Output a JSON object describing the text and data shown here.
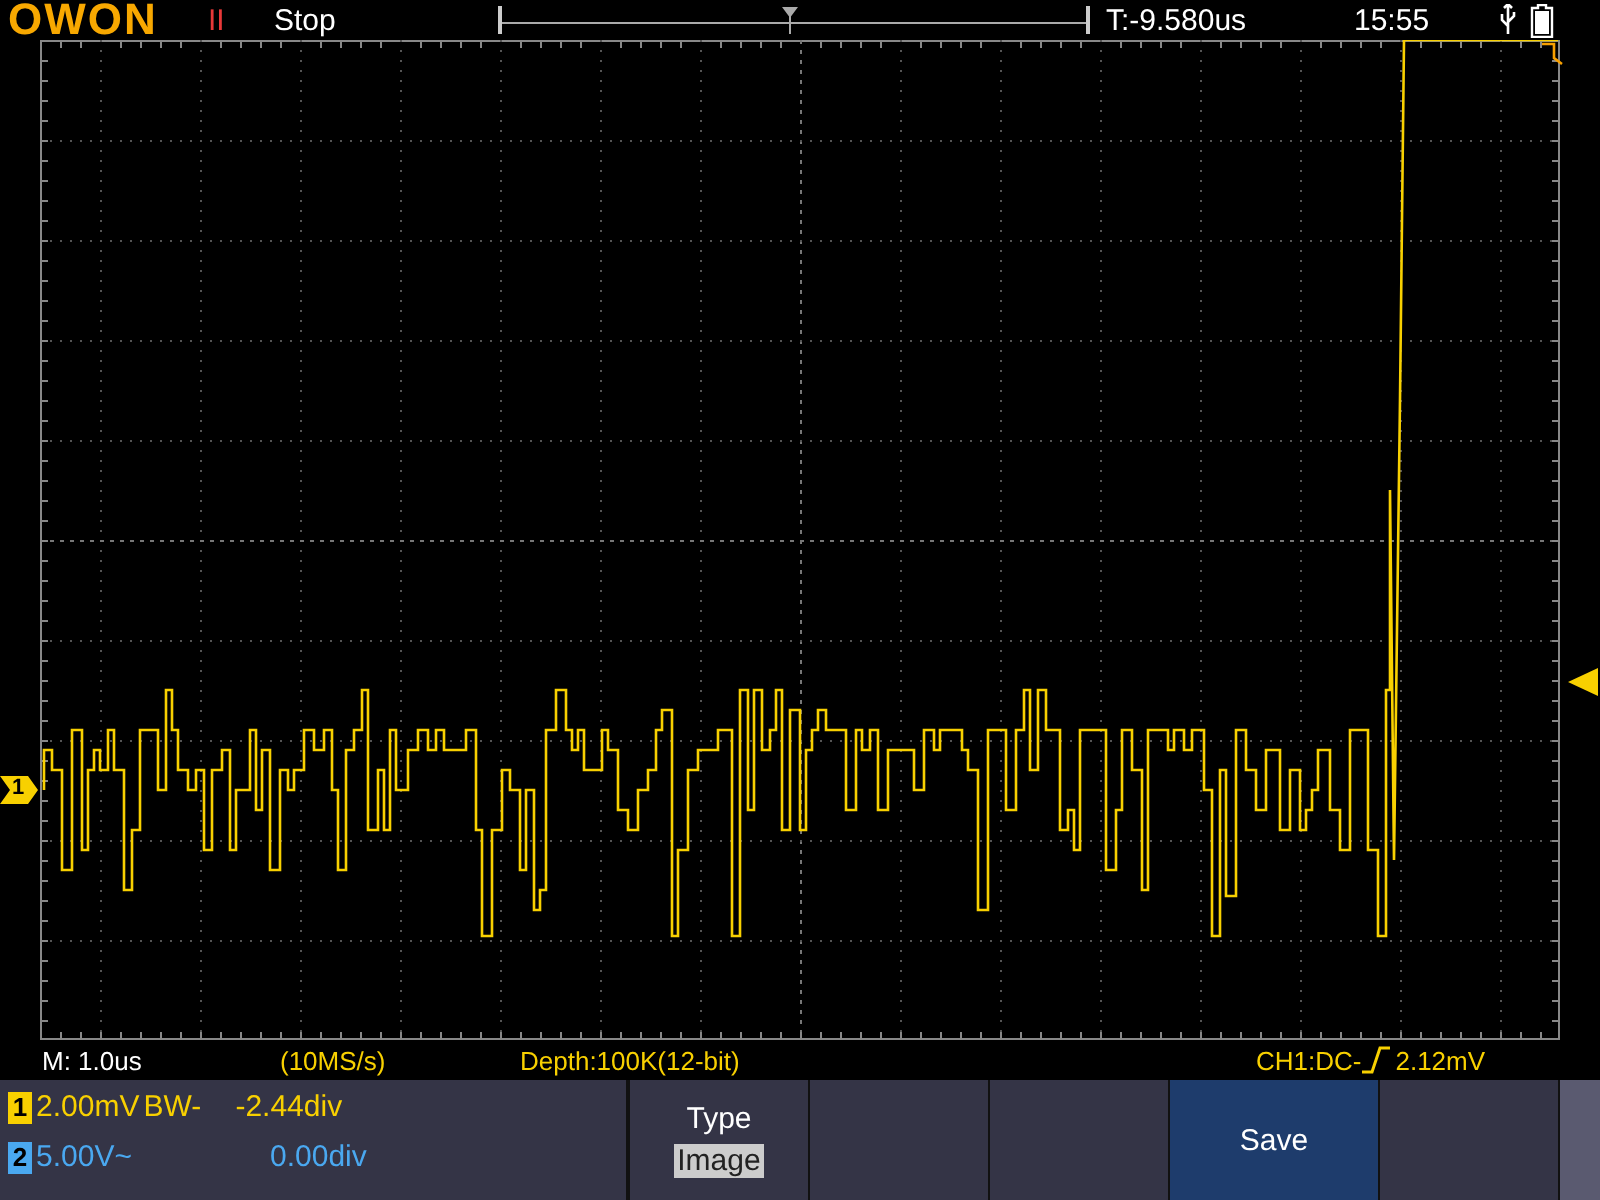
{
  "header": {
    "logo": "OWON",
    "run_indicator": "II",
    "status": "Stop",
    "trigger_time": "T:-9.580us",
    "clock": "15:55"
  },
  "info_bar": {
    "timebase": "M: 1.0us",
    "sample_rate": "(10MS/s)",
    "depth": "Depth:100K(12-bit)",
    "trigger_source": "CH1:DC-",
    "trigger_level": "2.12mV"
  },
  "channels": [
    {
      "number": "1",
      "scale": "2.00mV",
      "coupling": "BW-",
      "offset": "-2.44div",
      "color": "#f8d000"
    },
    {
      "number": "2",
      "scale": "5.00V~",
      "offset": "0.00div",
      "color": "#4aa8f0"
    }
  ],
  "screen": {
    "channel_marker": "1"
  },
  "menu": [
    {
      "kind": "option",
      "label": "Type",
      "value": "Image",
      "selected": false
    },
    {
      "kind": "blank",
      "selected": false
    },
    {
      "kind": "blank",
      "selected": false
    },
    {
      "kind": "button",
      "label": "Save",
      "selected": true
    },
    {
      "kind": "blank",
      "selected": false
    }
  ]
}
